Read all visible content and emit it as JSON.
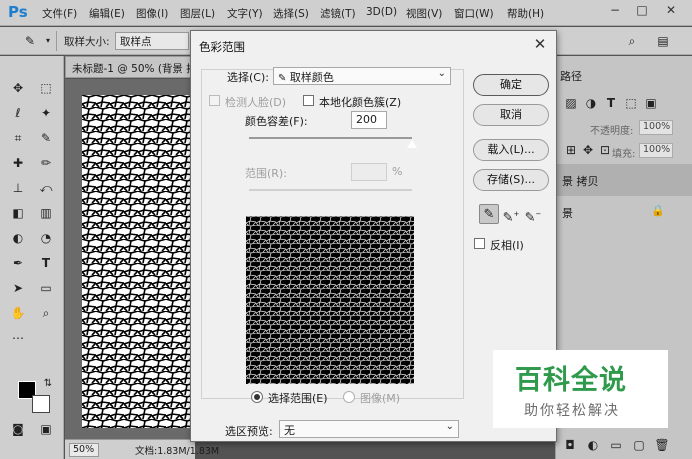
{
  "app": {
    "logo": "Ps"
  },
  "menubar": {
    "items": [
      "文件(F)",
      "编辑(E)",
      "图像(I)",
      "图层(L)",
      "文字(Y)",
      "选择(S)",
      "滤镜(T)",
      "3D(D)",
      "视图(V)",
      "窗口(W)",
      "帮助(H)"
    ],
    "min_icon": "minimize-icon",
    "max_icon": "maximize-icon",
    "close_icon": "close-icon"
  },
  "options": {
    "sample_size_label": "取样大小:",
    "sample_size_value": "取样点"
  },
  "document": {
    "tab_title": "未标题-1 @ 50% (背景 拷贝",
    "zoom": "50%",
    "doc_size": "文档:1.83M/1.83M"
  },
  "right_panel": {
    "tab": "路径",
    "opacity_label": "不透明度:",
    "opacity_value": "100%",
    "fill_label": "填充:",
    "fill_value": "100%",
    "layers": [
      {
        "name": "景 拷贝"
      },
      {
        "name": "景"
      }
    ]
  },
  "dialog": {
    "title": "色彩范围",
    "select_label": "选择(C):",
    "select_value": "取样颜色",
    "detect_faces_label": "检测人脸(D)",
    "localized_label": "本地化颜色簇(Z)",
    "fuzziness_label": "颜色容差(F):",
    "fuzziness_value": "200",
    "fuzziness_level": 1.0,
    "range_label": "范围(R):",
    "range_unit": "%",
    "radio_selection_label": "选择范围(E)",
    "radio_image_label": "图像(M)",
    "preview_label": "选区预览:",
    "preview_value": "无",
    "buttons": {
      "ok": "确定",
      "cancel": "取消",
      "load": "载入(L)...",
      "save": "存储(S)..."
    },
    "invert_label": "反相(I)"
  },
  "watermark": {
    "main": "百科全说",
    "sub": "助你轻松解决"
  },
  "colors": {
    "ps_blue": "#1f7fcf",
    "watermark_green": "#2f9a4b",
    "ui_gray": "#cfcfcf"
  }
}
